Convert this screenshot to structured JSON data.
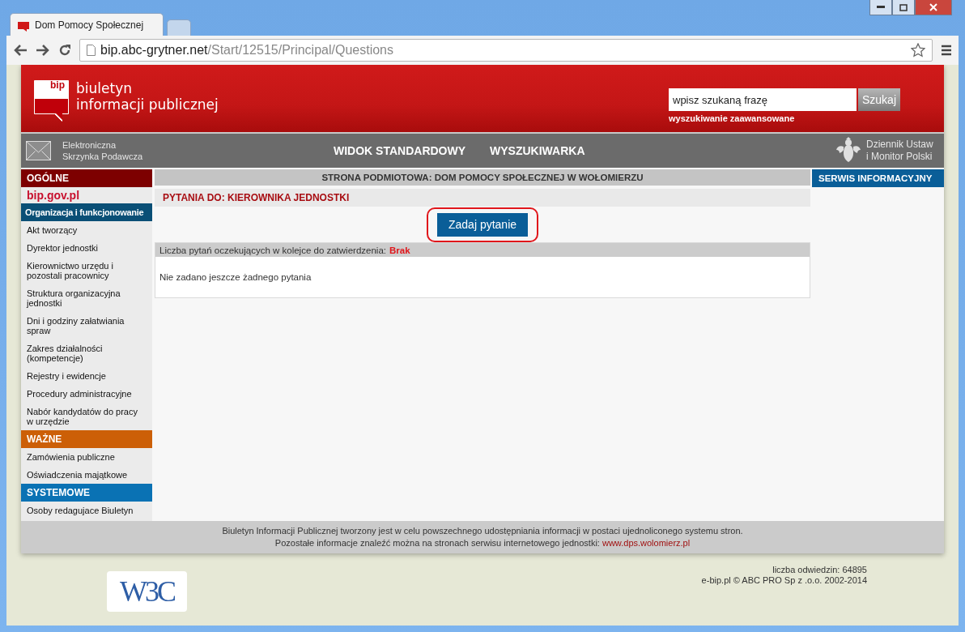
{
  "browser": {
    "tabs": [
      {
        "title": "Dom Pomocy Społecznej",
        "selected": true
      },
      {
        "selected": false
      }
    ],
    "url_host": "bip.abc-grytner.net",
    "url_path": "/Start/12515/Principal/Questions"
  },
  "header": {
    "logo_mark": "bip",
    "logo_line_1": "biuletyn",
    "logo_line_2": "informacji publicznej",
    "search": {
      "value": "wpisz szukaną frazę",
      "button": "Szukaj",
      "advanced_link": "wyszukiwanie zaawansowane"
    }
  },
  "nav": {
    "inbox_line_1": "Elektroniczna",
    "inbox_line_2": "Skrzynka Podawcza",
    "links": [
      "WIDOK STANDARDOWY",
      "WYSZUKIWARKA"
    ],
    "journal_line_1": "Dziennik Ustaw",
    "journal_line_2": "i Monitor Polski"
  },
  "sidebar": [
    {
      "kind": "section",
      "label": "OGÓLNE",
      "color": "#7d0000"
    },
    {
      "kind": "logo",
      "label": "bip.gov.pl"
    },
    {
      "kind": "category",
      "label": "Organizacja i funkcjonowanie"
    },
    {
      "kind": "item",
      "label": "Akt tworzący"
    },
    {
      "kind": "item",
      "label": "Dyrektor jednostki"
    },
    {
      "kind": "item",
      "label": "Kierownictwo urzędu i pozostali pracownicy"
    },
    {
      "kind": "item",
      "label": "Struktura organizacyjna jednostki"
    },
    {
      "kind": "item",
      "label": "Dni i godziny załatwiania spraw"
    },
    {
      "kind": "item",
      "label": "Zakres działalności (kompetencje)"
    },
    {
      "kind": "item",
      "label": "Rejestry i ewidencje"
    },
    {
      "kind": "item",
      "label": "Procedury administracyjne"
    },
    {
      "kind": "item",
      "label": "Nabór kandydatów do pracy w urzędzie"
    },
    {
      "kind": "section",
      "label": "WAŻNE",
      "color": "#cc5f07"
    },
    {
      "kind": "item",
      "label": "Zamówienia publiczne"
    },
    {
      "kind": "item",
      "label": "Oświadczenia majątkowe"
    },
    {
      "kind": "section",
      "label": "SYSTEMOWE",
      "color": "#0a72b4"
    },
    {
      "kind": "item",
      "label": "Osoby redagujace Biuletyn"
    }
  ],
  "main": {
    "page_title": "STRONA PODMIOTOWA: DOM POMOCY SPOŁECZNEJ W WOŁOMIERZU",
    "questions_title": "PYTANIA DO: KIEROWNIKA JEDNOSTKI",
    "ask_button": {
      "label": "Zadaj pytanie",
      "highlighted": true
    },
    "queue_label": "Liczba pytań oczekujących w kolejce do zatwierdzenia:",
    "queue_value": "Brak",
    "empty_message": "Nie zadano jeszcze żadnego pytania"
  },
  "right_panel": {
    "title": "SERWIS INFORMACYJNY"
  },
  "footer": {
    "line_1": "Biuletyn Informacji Publicznej tworzony jest w celu powszechnego udostępniania informacji w postaci ujednoliconego systemu stron.",
    "line_2": "Pozostałe informacje znaleźć można na stronach serwisu internetowego jednostki:",
    "link": "www.dps.wolomierz.pl"
  },
  "below_footer": {
    "w3c": "W3C",
    "visits": "liczba odwiedzin: 64895",
    "copyright": "e-bip.pl © ABC PRO Sp z .o.o. 2002-2014"
  }
}
